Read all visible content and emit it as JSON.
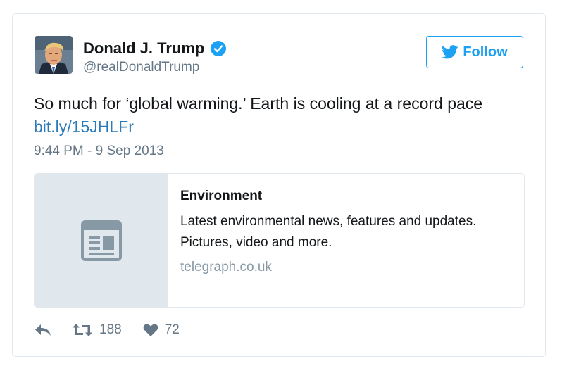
{
  "author": {
    "name": "Donald J. Trump",
    "handle": "@realDonaldTrump",
    "verified": true
  },
  "follow_button": {
    "label": "Follow"
  },
  "tweet": {
    "text": "So much for ‘global warming.’ Earth is cooling at a record pace",
    "link": "bit.ly/15JHLFr",
    "timestamp": "9:44 PM - 9 Sep 2013"
  },
  "link_card": {
    "title": "Environment",
    "description_line1": "Latest environmental news, features and updates.",
    "description_line2": "Pictures, video and more.",
    "domain": "telegraph.co.uk",
    "thumbnail_icon": "article-icon"
  },
  "actions": {
    "retweets": "188",
    "likes": "72"
  },
  "colors": {
    "accent": "#1da1f2",
    "link": "#2b7bb9",
    "muted": "#657786",
    "border": "#e1e8ed"
  }
}
